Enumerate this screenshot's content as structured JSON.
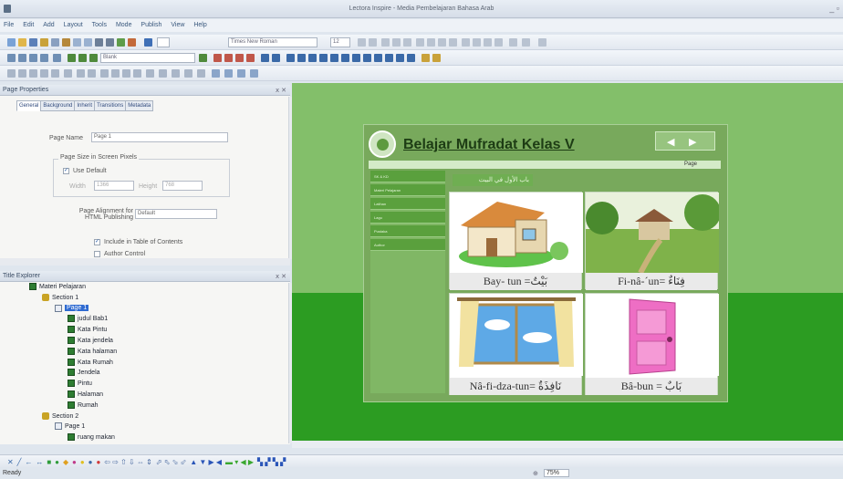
{
  "window": {
    "title": "Lectora Inspire - Media Pembelajaran Bahasa Arab",
    "controls": "_ ▫"
  },
  "menu": [
    "File",
    "Edit",
    "Add",
    "Layout",
    "Tools",
    "Mode",
    "Publish",
    "View",
    "Help"
  ],
  "toolbar": {
    "font_name": "Times New Roman",
    "font_size": "12",
    "page_template": "Blank"
  },
  "page_properties": {
    "header": "Page Properties",
    "tabs": [
      "General",
      "Background",
      "Inherit",
      "Transitions",
      "Metadata"
    ],
    "page_name_label": "Page Name",
    "page_name_value": "Page 1",
    "size_group_label": "Page Size in Screen Pixels",
    "use_default_label": "Use Default",
    "width_label": "Width",
    "width_value": "1366",
    "height_label": "Height",
    "height_value": "768",
    "alignment_label": "Page Alignment for HTML Publishing",
    "alignment_value": "Default",
    "toc_label": "Include in Table of Contents",
    "author_control_label": "Author Control"
  },
  "title_explorer": {
    "header": "Title Explorer",
    "items": [
      {
        "label": "Materi Pelajaran",
        "type": "chapter",
        "indent": 0
      },
      {
        "label": "Section 1",
        "type": "section",
        "indent": 1
      },
      {
        "label": "Page 1",
        "type": "page",
        "indent": 2,
        "selected": true
      },
      {
        "label": "judul Bab1",
        "type": "item",
        "indent": 3
      },
      {
        "label": "Kata Pintu",
        "type": "item",
        "indent": 3
      },
      {
        "label": "Kata jendela",
        "type": "item",
        "indent": 3
      },
      {
        "label": "Kata halaman",
        "type": "item",
        "indent": 3
      },
      {
        "label": "Kata Rumah",
        "type": "item",
        "indent": 3
      },
      {
        "label": "Jendela",
        "type": "item",
        "indent": 3
      },
      {
        "label": "Pintu",
        "type": "item",
        "indent": 3
      },
      {
        "label": "Halaman",
        "type": "item",
        "indent": 3
      },
      {
        "label": "Rumah",
        "type": "item",
        "indent": 3
      },
      {
        "label": "Section 2",
        "type": "section",
        "indent": 1
      },
      {
        "label": "Page 1",
        "type": "page",
        "indent": 2
      },
      {
        "label": "ruang makan",
        "type": "item",
        "indent": 3
      }
    ]
  },
  "slide": {
    "title": "Belajar Mufradat Kelas V",
    "page_label": "Page",
    "menu_items": [
      "SK & KD",
      "Materi Pelajaran",
      "Latihan",
      "Lagu",
      "Pustaka",
      "Author"
    ],
    "chapter_heading": "باب الأول في البيت",
    "cards": [
      {
        "caption": "Bay- tun =بَيْتٌ"
      },
      {
        "caption": "Fi-nâ-´un= فِنَاءٌ"
      },
      {
        "caption": "Nâ-fi-dza-tun= نَافِذَةٌ"
      },
      {
        "caption": "Bâ-bun = بَابٌ"
      }
    ]
  },
  "status": {
    "text": "Ready",
    "zoom": "75%"
  },
  "colors": {
    "workspace_light": "#83bf6a",
    "workspace_dark": "#2c9c22",
    "selection": "#2f6bd1"
  }
}
